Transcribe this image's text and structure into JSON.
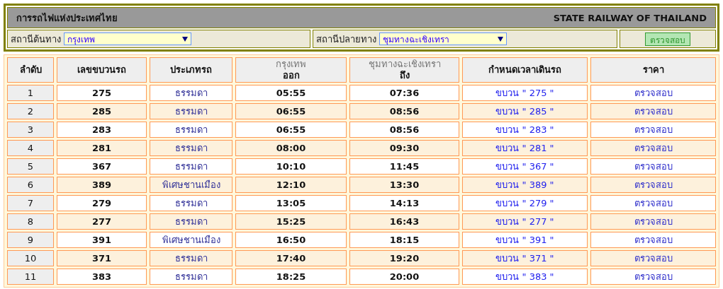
{
  "header": {
    "title": "การรถไฟแห่งประเทศไทย",
    "title_en": "STATE RAILWAY OF THAILAND"
  },
  "origin": {
    "label": "สถานีต้นทาง",
    "value": "กรุงเทพ"
  },
  "destination": {
    "label": "สถานีปลายทาง",
    "value": "ชุมทางฉะเชิงเทรา"
  },
  "check_button": "ตรวจสอบ",
  "table": {
    "columns": [
      {
        "label": "ลำดับ"
      },
      {
        "label": "เลขขบวนรถ"
      },
      {
        "label": "ประเภทรถ"
      },
      {
        "station": "กรุงเทพ",
        "label": "ออก"
      },
      {
        "station": "ชุมทางฉะเชิงเทรา",
        "label": "ถึง"
      },
      {
        "label": "กำหนดเวลาเดินรถ"
      },
      {
        "label": "ราคา"
      }
    ],
    "rows": [
      {
        "no": "1",
        "train": "275",
        "type": "ธรรมดา",
        "depart": "05:55",
        "arrive": "07:36",
        "schedule": "ขบวน \" 275 \"",
        "price": "ตรวจสอบ"
      },
      {
        "no": "2",
        "train": "285",
        "type": "ธรรมดา",
        "depart": "06:55",
        "arrive": "08:56",
        "schedule": "ขบวน \" 285 \"",
        "price": "ตรวจสอบ"
      },
      {
        "no": "3",
        "train": "283",
        "type": "ธรรมดา",
        "depart": "06:55",
        "arrive": "08:56",
        "schedule": "ขบวน \" 283 \"",
        "price": "ตรวจสอบ"
      },
      {
        "no": "4",
        "train": "281",
        "type": "ธรรมดา",
        "depart": "08:00",
        "arrive": "09:30",
        "schedule": "ขบวน \" 281 \"",
        "price": "ตรวจสอบ"
      },
      {
        "no": "5",
        "train": "367",
        "type": "ธรรมดา",
        "depart": "10:10",
        "arrive": "11:45",
        "schedule": "ขบวน \" 367 \"",
        "price": "ตรวจสอบ"
      },
      {
        "no": "6",
        "train": "389",
        "type": "พิเศษชานเมือง",
        "depart": "12:10",
        "arrive": "13:30",
        "schedule": "ขบวน \" 389 \"",
        "price": "ตรวจสอบ"
      },
      {
        "no": "7",
        "train": "279",
        "type": "ธรรมดา",
        "depart": "13:05",
        "arrive": "14:13",
        "schedule": "ขบวน \" 279 \"",
        "price": "ตรวจสอบ"
      },
      {
        "no": "8",
        "train": "277",
        "type": "ธรรมดา",
        "depart": "15:25",
        "arrive": "16:43",
        "schedule": "ขบวน \" 277 \"",
        "price": "ตรวจสอบ"
      },
      {
        "no": "9",
        "train": "391",
        "type": "พิเศษชานเมือง",
        "depart": "16:50",
        "arrive": "18:15",
        "schedule": "ขบวน \" 391 \"",
        "price": "ตรวจสอบ"
      },
      {
        "no": "10",
        "train": "371",
        "type": "ธรรมดา",
        "depart": "17:40",
        "arrive": "19:20",
        "schedule": "ขบวน \" 371 \"",
        "price": "ตรวจสอบ"
      },
      {
        "no": "11",
        "train": "383",
        "type": "ธรรมดา",
        "depart": "18:25",
        "arrive": "20:00",
        "schedule": "ขบวน \" 383 \"",
        "price": "ตรวจสอบ"
      }
    ]
  }
}
